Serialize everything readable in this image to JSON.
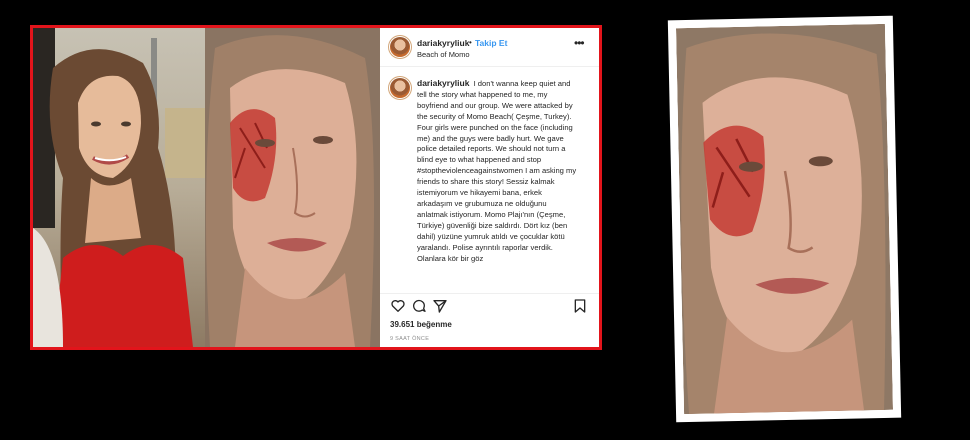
{
  "post": {
    "username": "dariakyryliuk",
    "separator": "•",
    "follow_label": "Takip Et",
    "location": "Beach of Momo",
    "more_label": "•••",
    "caption_username": "dariakyryliuk",
    "caption_text": "I don't wanna keep quiet and tell the story what happened to me, my boyfriend and our group. We were attacked by the security of Momo Beach( Çeşme, Turkey). Four girls were punched on the face (including me) and the guys were badly hurt. We gave police detailed reports. We should not turn a blind eye to what happened and stop #stoptheviolenceagainstwomen I am asking my friends to share this story! Sessiz kalmak istemiyorum ve hikayemi bana, erkek arkadaşım ve grubumuza ne olduğunu anlatmak istiyorum. Momo Plajı'nın (Çeşme, Türkiye) güvenliği bize saldırdı. Dört kız (ben dahil) yüzüne yumruk atıldı ve çocuklar kötü yaralandı. Polise ayrıntılı raporlar verdik. Olanlara kör bir göz",
    "likes": "39.651 beğenme",
    "time": "9 SAAT ÖNCE"
  },
  "colors": {
    "frame_border": "#e2141b",
    "link_blue": "#3897f0",
    "text": "#262626",
    "muted": "#8e8e8e"
  },
  "icons": [
    "heart-icon",
    "comment-icon",
    "share-icon",
    "bookmark-icon",
    "more-options-icon"
  ]
}
